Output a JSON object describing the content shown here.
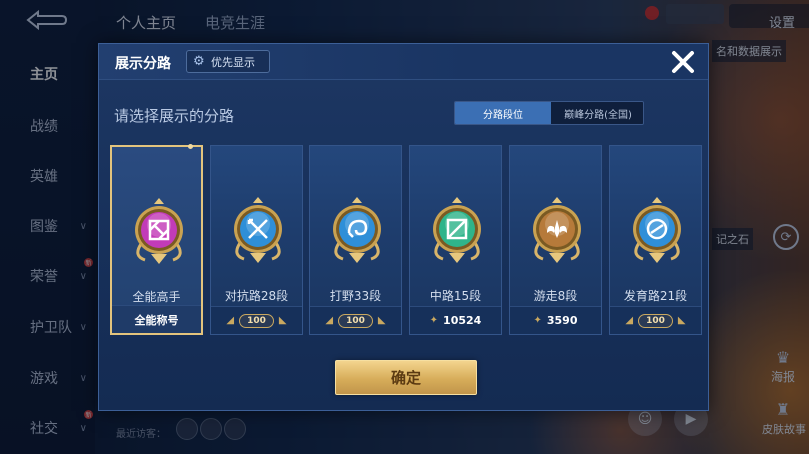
{
  "background": {
    "back_icon": "back-arrow-icon",
    "tabs": [
      "个人主页",
      "电竞生涯"
    ],
    "settings_label": "设置",
    "sidebar": [
      {
        "label": "主页",
        "active": true
      },
      {
        "label": "战绩",
        "active": false
      },
      {
        "label": "英雄",
        "active": false
      },
      {
        "label": "图鉴",
        "active": false,
        "chevron": true
      },
      {
        "label": "荣誉",
        "active": false,
        "chevron": true,
        "badge": "新"
      },
      {
        "label": "护卫队",
        "active": false,
        "chevron": true
      },
      {
        "label": "游戏",
        "active": false,
        "chevron": true
      },
      {
        "label": "社交",
        "active": false,
        "chevron": true,
        "badge": "新"
      }
    ],
    "right_panel_text": "名和数据展示",
    "right_side_text": "记之石",
    "right_labels": [
      "海报",
      "皮肤故事"
    ],
    "visitors_label": "最近访客："
  },
  "modal": {
    "title": "展示分路",
    "priority_label": "优先显示",
    "close_icon": "close-icon",
    "subtitle": "请选择展示的分路",
    "toggle": [
      {
        "label": "分路段位",
        "active": true
      },
      {
        "label": "巅峰分路(全国)",
        "active": false
      }
    ],
    "cards": [
      {
        "name": "全能高手",
        "footer_type": "text",
        "footer": "全能称号",
        "selected": true,
        "color": "#c23bb8",
        "icon": "all-round-icon"
      },
      {
        "name": "对抗路28段",
        "footer_type": "badge",
        "footer": "100",
        "selected": false,
        "color": "#2f8fd8",
        "icon": "crossed-swords-icon"
      },
      {
        "name": "打野33段",
        "footer_type": "badge",
        "footer": "100",
        "selected": false,
        "color": "#2f8fd8",
        "icon": "dragon-icon"
      },
      {
        "name": "中路15段",
        "footer_type": "score",
        "footer": "10524",
        "selected": false,
        "color": "#2fb48a",
        "icon": "mid-lane-icon"
      },
      {
        "name": "游走8段",
        "footer_type": "score",
        "footer": "3590",
        "selected": false,
        "color": "#b67a3a",
        "icon": "wings-icon"
      },
      {
        "name": "发育路21段",
        "footer_type": "badge",
        "footer": "100",
        "selected": false,
        "color": "#2f8fd8",
        "icon": "target-icon"
      }
    ],
    "confirm_label": "确定"
  }
}
